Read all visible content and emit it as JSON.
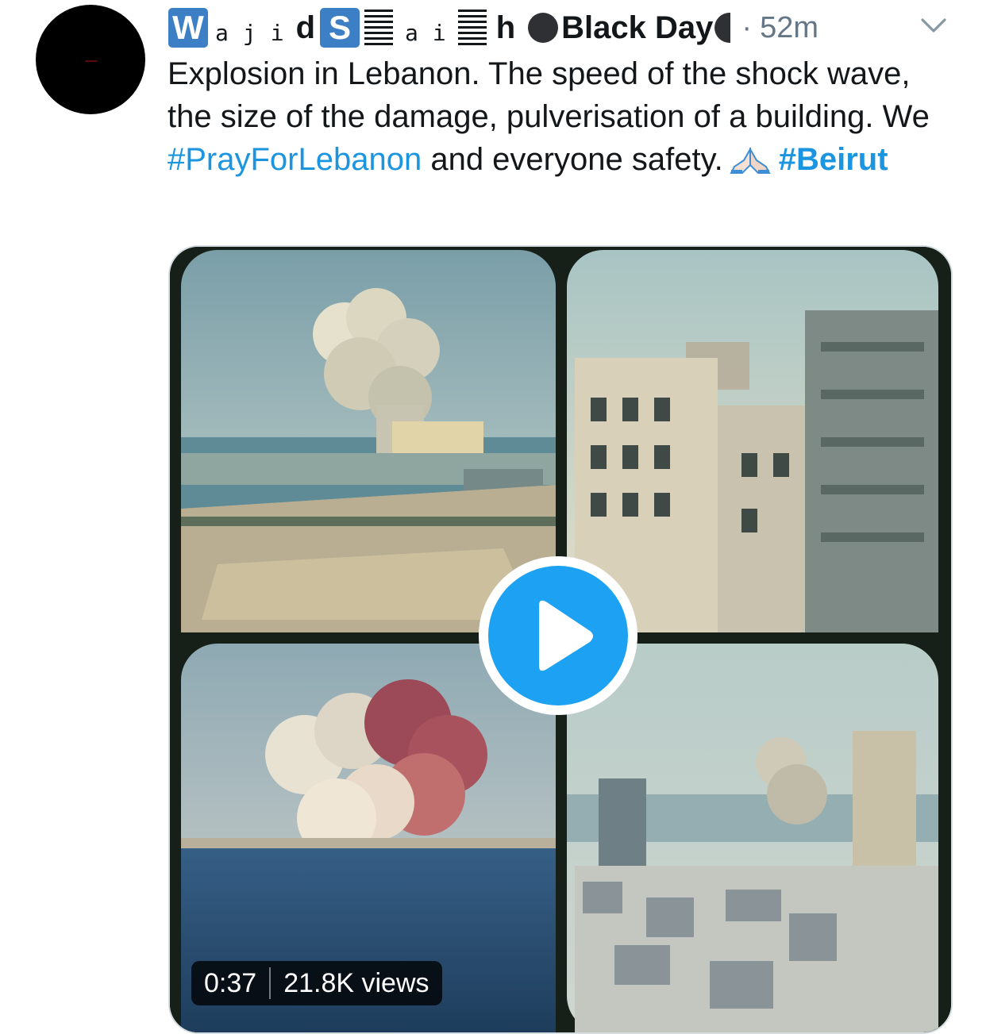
{
  "tweet": {
    "author": {
      "name_parts": [
        "W",
        "a",
        "j",
        "i",
        "d",
        "S",
        "a",
        "i",
        "h"
      ],
      "suffix": "Black Day"
    },
    "separator": "·",
    "time": "52m",
    "text_parts": {
      "line_a": "Explosion in Lebanon. The speed of the shock wave, the size of the damage, pulverisation of a building. We ",
      "hashtag1": "#PrayForLebanon",
      "line_b": " and everyone safety.",
      "hashtag2": "#Beirut"
    },
    "icons": {
      "avatar": "avatar",
      "more": "chevron-down-icon",
      "emoji": "folded-hands-emoji",
      "play": "play-icon"
    },
    "media": {
      "duration": "0:37",
      "views": "21.8K views"
    },
    "colors": {
      "link": "#1b95e0",
      "play": "#1da1f2",
      "meta": "#657786"
    }
  }
}
